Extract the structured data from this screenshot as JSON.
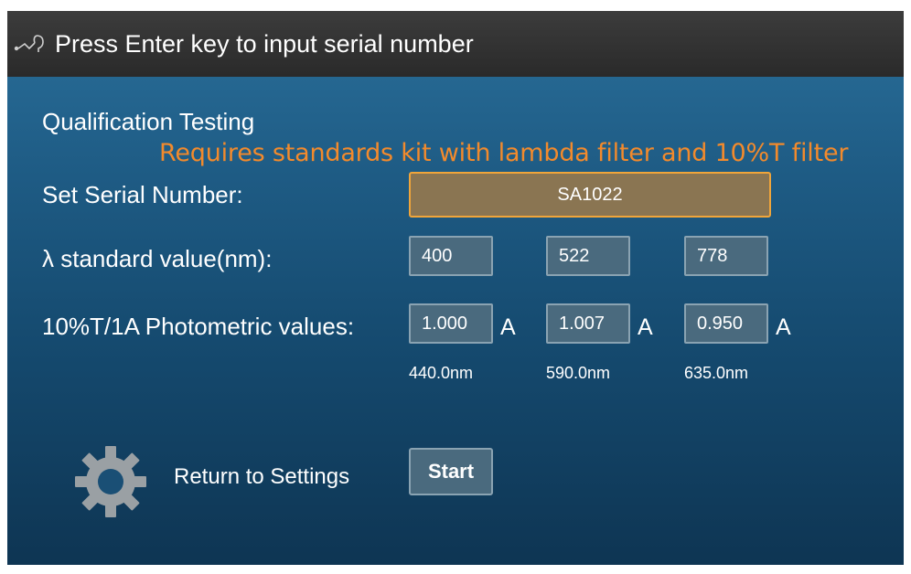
{
  "titlebar": {
    "icon": "wand-icon",
    "title": "Press Enter key to input serial number"
  },
  "main": {
    "heading": "Qualification Testing",
    "warning": "Requires standards kit with lambda filter and 10%T filter",
    "serial": {
      "label": "Set Serial Number:",
      "value": "SA1022"
    },
    "lambda": {
      "label": "λ standard value(nm):",
      "values": [
        "400",
        "522",
        "778"
      ]
    },
    "photometric": {
      "label": "10%T/1A Photometric values:",
      "values": [
        "1.000",
        "1.007",
        "0.950"
      ],
      "unit": "A",
      "wavelengths": [
        "440.0nm",
        "590.0nm",
        "635.0nm"
      ]
    }
  },
  "footer": {
    "gear_icon": "gear-icon",
    "return_label": "Return to Settings",
    "start_label": "Start"
  },
  "colors": {
    "warning": "#f28a2c",
    "serial_fill": "#8a7552",
    "serial_border": "#f0a53a",
    "field_fill": "#4a6a7e"
  }
}
